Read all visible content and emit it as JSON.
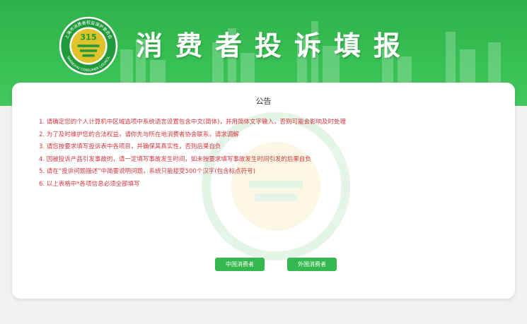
{
  "header": {
    "title": "消费者投诉填报",
    "logo": {
      "arc_text": "上海市消费者权益保护委员会",
      "bottom_text": "SHANGHAI CONSUMER COUNCIL",
      "emblem_number": "315",
      "icon": "ssc-emblem-logo"
    }
  },
  "notice": {
    "title": "公告",
    "items": [
      "1. 请确定您的个人计算机中区域选项中系统语言设置包含中文(简体)，并用简体文字输入，否则可能会影响及时处理",
      "2. 为了及时维护您的合法权益，请你先与所在地消费者协会联系，请求调解",
      "3. 请您按要求填写投诉表中各项目，并确保其真实性，否则后果自负",
      "4. 因被投诉产品引发事故的，请一定填写事故发生时间，如未按要求填写事故发生时间引发的后果自负",
      "5. 请在“投诉问题描述”中简要说明问题，系统只能接受500个汉字(包含标点符号)",
      "6. 以上表格中*各项信息必须全部填写"
    ]
  },
  "buttons": {
    "chinese_consumer": "中国消费者",
    "foreign_consumer": "外国消费者"
  },
  "colors": {
    "banner_green": "#37c053",
    "button_green": "#35b84f",
    "notice_red": "#d9363e",
    "logo_gold": "#e0c32a"
  }
}
